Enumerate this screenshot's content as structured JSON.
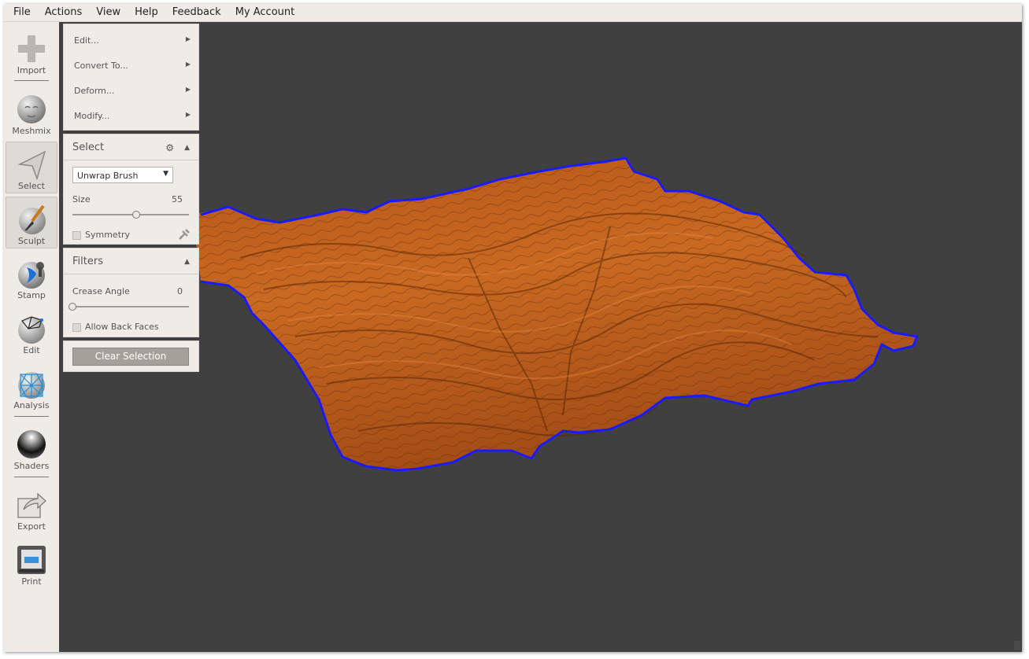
{
  "menu": [
    "File",
    "Actions",
    "View",
    "Help",
    "Feedback",
    "My Account"
  ],
  "toolbar": {
    "items": [
      {
        "key": "import",
        "label": "Import",
        "icon": "plus-icon"
      },
      {
        "key": "meshmix",
        "label": "Meshmix",
        "icon": "bunny-head-icon"
      },
      {
        "key": "select",
        "label": "Select",
        "icon": "cursor-arrow-icon",
        "active": true
      },
      {
        "key": "sculpt",
        "label": "Sculpt",
        "icon": "brush-icon",
        "active": true
      },
      {
        "key": "stamp",
        "label": "Stamp",
        "icon": "stamp-icon"
      },
      {
        "key": "edit",
        "label": "Edit",
        "icon": "edit-mesh-icon"
      },
      {
        "key": "analysis",
        "label": "Analysis",
        "icon": "analysis-mesh-icon"
      },
      {
        "key": "shaders",
        "label": "Shaders",
        "icon": "shader-sphere-icon"
      },
      {
        "key": "export",
        "label": "Export",
        "icon": "export-arrow-icon"
      },
      {
        "key": "print",
        "label": "Print",
        "icon": "printer-icon"
      }
    ]
  },
  "selection_menu": {
    "items": [
      "Edit...",
      "Convert To...",
      "Deform...",
      "Modify..."
    ],
    "arrow": "▶"
  },
  "select_panel": {
    "title": "Select",
    "brush": "Unwrap Brush",
    "size_label": "Size",
    "size_value": "55",
    "size_fraction": 0.55,
    "symmetry_label": "Symmetry"
  },
  "filters_panel": {
    "title": "Filters",
    "crease_label": "Crease Angle",
    "crease_value": "0",
    "crease_fraction": 0.0,
    "back_faces_label": "Allow Back Faces"
  },
  "clear_selection_label": "Clear Selection",
  "colors": {
    "viewport_bg": "#404040",
    "terrain": "#c2621a",
    "selection_outline": "#1a1aff",
    "panel_bg": "#efebe7"
  }
}
